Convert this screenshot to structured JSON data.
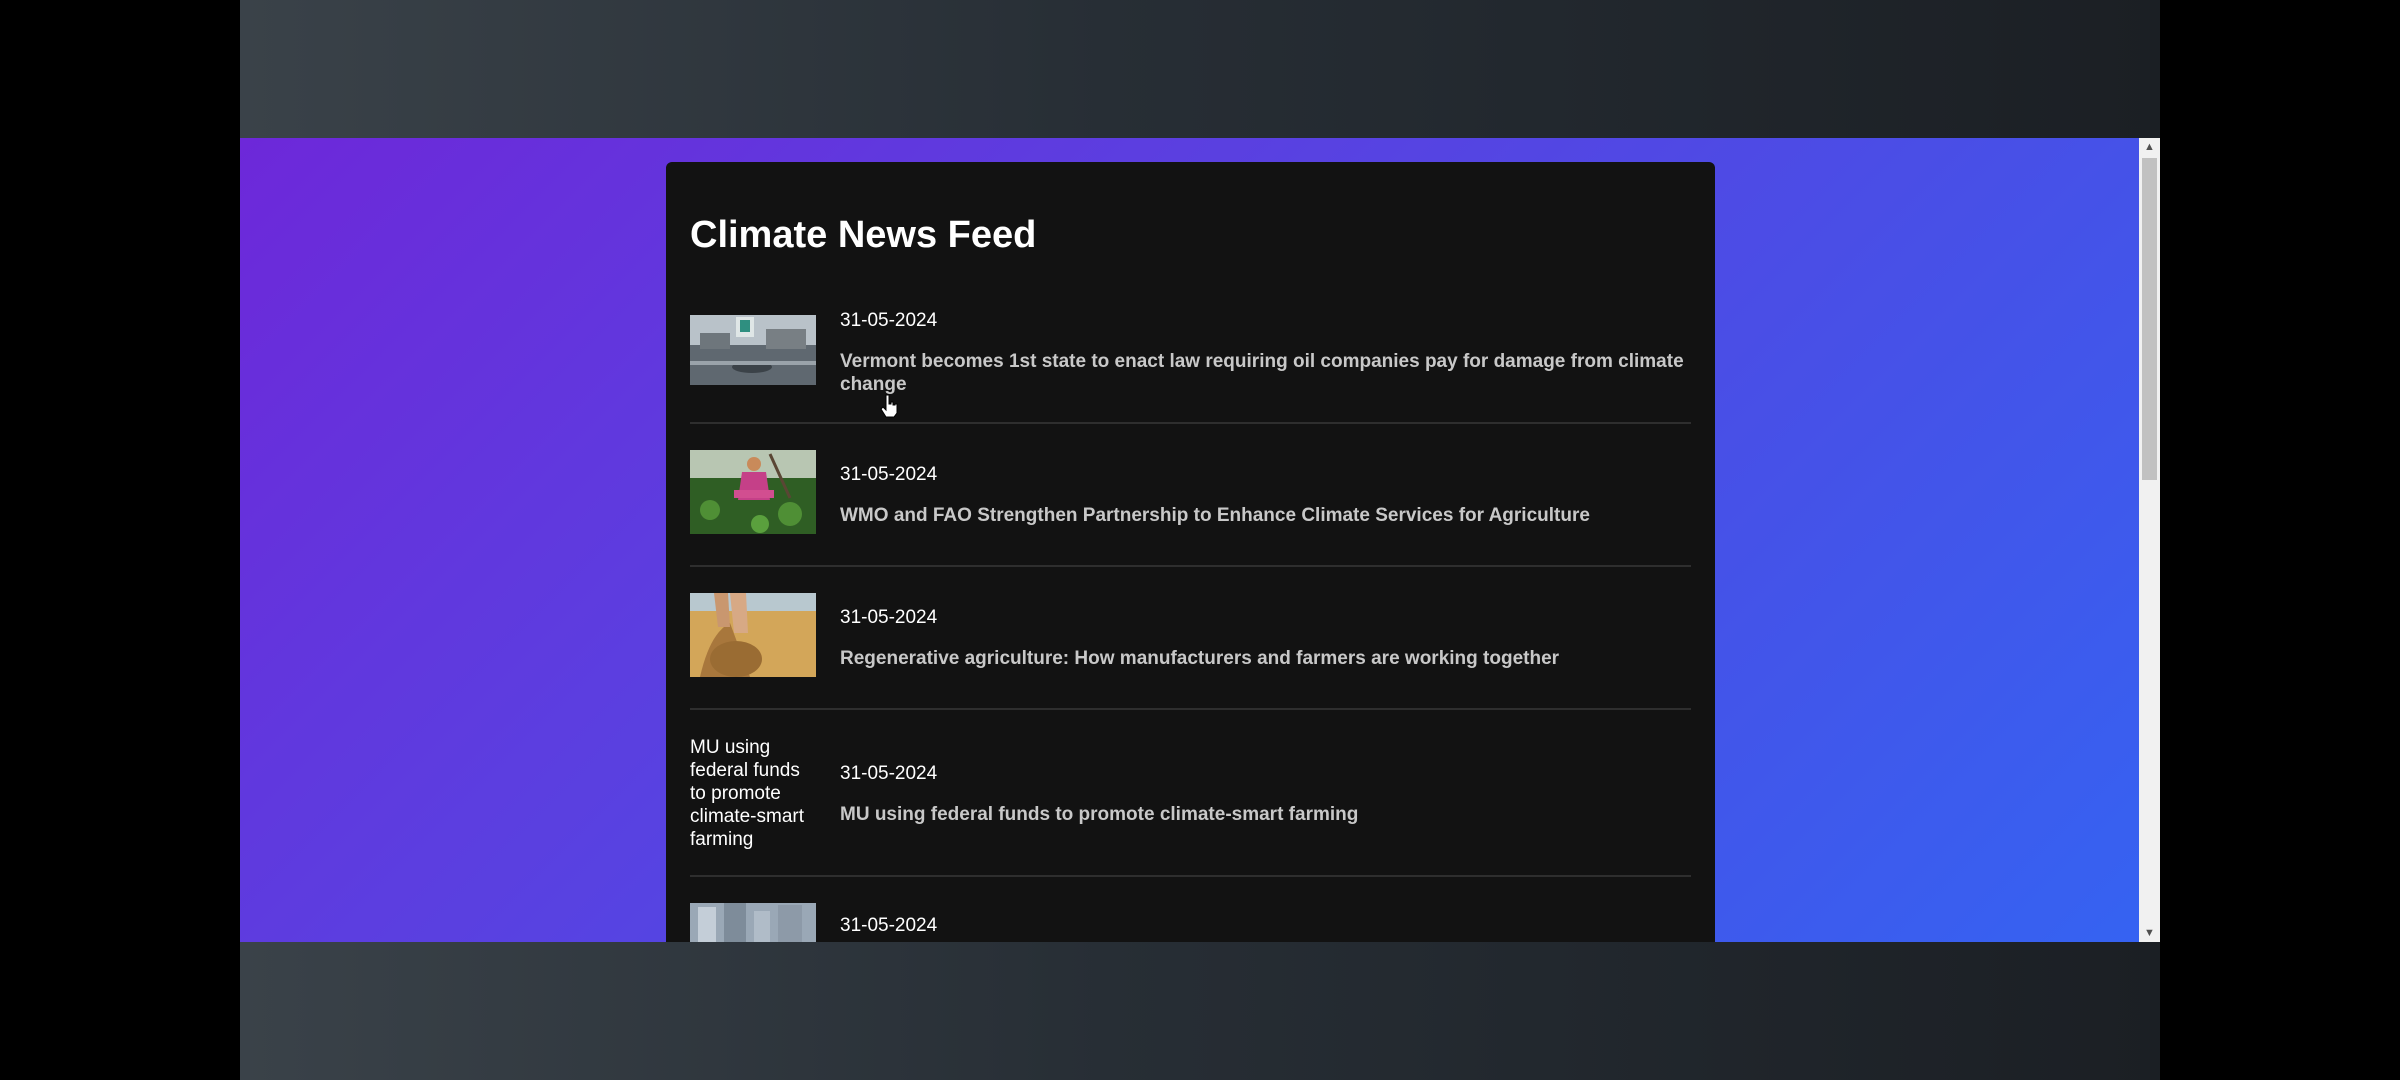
{
  "feed": {
    "title": "Climate News Feed",
    "items": [
      {
        "date": "31-05-2024",
        "headline": "Vermont becomes 1st state to enact law requiring oil companies pay for damage from climate change",
        "image": "flood-photo"
      },
      {
        "date": "31-05-2024",
        "headline": "WMO and FAO Strengthen Partnership to Enhance Climate Services for Agriculture",
        "image": "farmer-photo"
      },
      {
        "date": "31-05-2024",
        "headline": "Regenerative agriculture: How manufacturers and farmers are working together",
        "image": "wheat-photo"
      },
      {
        "date": "31-05-2024",
        "headline": "MU using federal funds to promote climate-smart farming",
        "image_alt": "MU using federal funds to promote climate-smart farming"
      },
      {
        "date": "31-05-2024",
        "image": "city-photo"
      }
    ]
  },
  "colors": {
    "card": "#121212",
    "gradient_start": "#6d28d9",
    "gradient_end": "#3563f2",
    "headline": "#c8c8c8",
    "date": "#ffffff"
  }
}
